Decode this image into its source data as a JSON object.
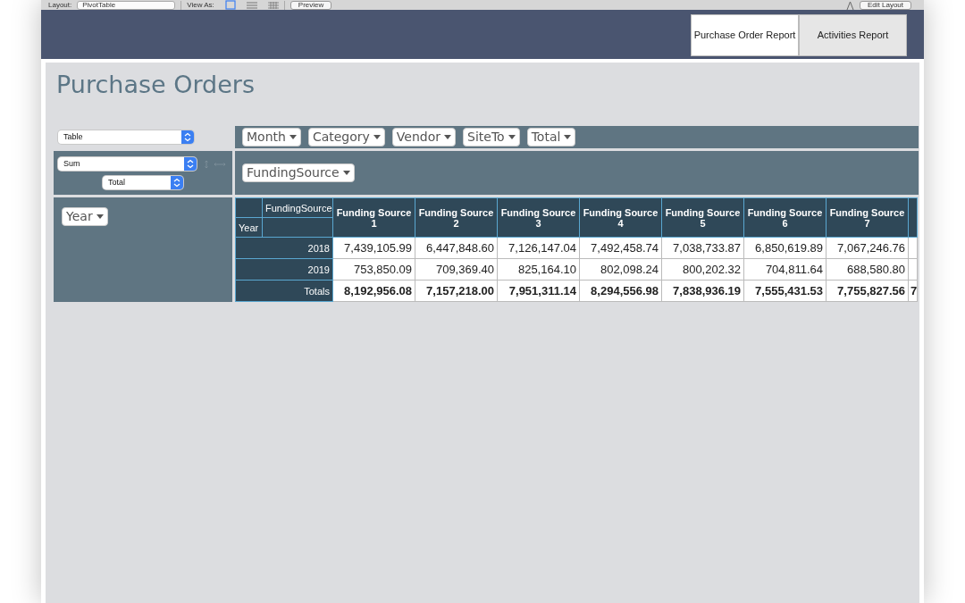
{
  "toolbar": {
    "layout_label": "Layout:",
    "layout_value": "PivotTable",
    "view_as_label": "View As:",
    "view_modes": [
      {
        "kind": "form",
        "selected": true
      },
      {
        "kind": "list",
        "selected": false
      },
      {
        "kind": "table",
        "selected": false
      }
    ],
    "preview_button": "Preview",
    "edit_layout_button": "Edit Layout"
  },
  "nav_tabs": [
    {
      "label": "Purchase Order Report",
      "selected": true
    },
    {
      "label": "Activities Report",
      "selected": false
    }
  ],
  "title": "Purchase Orders",
  "renderer_select": "Table",
  "aggregator_select": "Sum",
  "value_select": "Total",
  "unused_fields": [
    "Month",
    "Category",
    "Vendor",
    "SiteTo",
    "Total"
  ],
  "column_fields": [
    "FundingSource"
  ],
  "row_fields": [
    "Year"
  ],
  "table": {
    "col_attr": "FundingSource",
    "row_attr": "Year",
    "columns": [
      {
        "line1": "Funding Source",
        "line2": "1"
      },
      {
        "line1": "Funding Source",
        "line2": "2"
      },
      {
        "line1": "Funding Source",
        "line2": "3"
      },
      {
        "line1": "Funding Source",
        "line2": "4"
      },
      {
        "line1": "Funding Source",
        "line2": "5"
      },
      {
        "line1": "Funding Source",
        "line2": "6"
      },
      {
        "line1": "Funding Source",
        "line2": "7"
      }
    ],
    "rows": [
      {
        "label": "2018",
        "values": [
          "7,439,105.99",
          "6,447,848.60",
          "7,126,147.04",
          "7,492,458.74",
          "7,038,733.87",
          "6,850,619.89",
          "7,067,246.76"
        ]
      },
      {
        "label": "2019",
        "values": [
          "753,850.09",
          "709,369.40",
          "825,164.10",
          "802,098.24",
          "800,202.32",
          "704,811.64",
          "688,580.80"
        ]
      }
    ],
    "totals": {
      "label": "Totals",
      "values": [
        "8,192,956.08",
        "7,157,218.00",
        "7,951,311.14",
        "8,294,556.98",
        "7,838,936.19",
        "7,555,431.53",
        "7,755,827.56"
      ],
      "cut_value": "7"
    }
  }
}
